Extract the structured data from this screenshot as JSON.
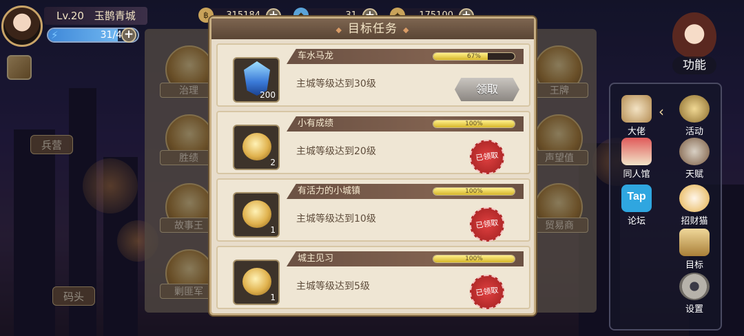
{
  "player": {
    "level_label": "Lv.20",
    "name": "玉鹊青城",
    "energy_text": "31/40",
    "energy_fraction": 0.775
  },
  "resources": [
    {
      "icon": "coin-icon",
      "value": "315184"
    },
    {
      "icon": "crystal-icon",
      "value": "31"
    },
    {
      "icon": "scroll-icon",
      "value": "175100"
    }
  ],
  "left_menu": {
    "buildings": [
      {
        "label": "治理"
      },
      {
        "label": "胜绩"
      },
      {
        "label": "故事王"
      },
      {
        "label": "剿匪军"
      }
    ],
    "side_labels": {
      "barracks": "兵营",
      "dock": "码头"
    }
  },
  "right_menu_behind": [
    {
      "label": "王牌"
    },
    {
      "label": "声望值"
    },
    {
      "label": "贸易商"
    }
  ],
  "right_functions": {
    "top": {
      "label": "功能"
    },
    "items": [
      {
        "label": "大佬",
        "icon": "boss-icon"
      },
      {
        "label": "活动",
        "icon": "event-icon"
      },
      {
        "label": "同人馆",
        "icon": "fan-hall-icon"
      },
      {
        "label": "天赋",
        "icon": "talent-icon"
      },
      {
        "label": "论坛",
        "icon": "tap-forum-icon",
        "badge": "Tap"
      },
      {
        "label": "招财猫",
        "icon": "lucky-cat-icon"
      },
      {
        "label": "目标",
        "icon": "goal-icon"
      },
      {
        "label": "设置",
        "icon": "settings-gear-icon"
      }
    ]
  },
  "modal": {
    "title": "目标任务",
    "tasks": [
      {
        "name": "车水马龙",
        "desc": "主城等级达到30级",
        "progress_text": "67%",
        "progress": 0.67,
        "reward_icon": "gem-icon",
        "reward_count": "200",
        "status": "claim",
        "button_label": "领取"
      },
      {
        "name": "小有成绩",
        "desc": "主城等级达到20级",
        "progress_text": "100%",
        "progress": 1.0,
        "reward_icon": "gold-coin-icon",
        "reward_count": "2",
        "status": "claimed",
        "stamp_label": "已领取"
      },
      {
        "name": "有活力的小城镇",
        "desc": "主城等级达到10级",
        "progress_text": "100%",
        "progress": 1.0,
        "reward_icon": "gold-coin-icon",
        "reward_count": "1",
        "status": "claimed",
        "stamp_label": "已领取"
      },
      {
        "name": "城主见习",
        "desc": "主城等级达到5级",
        "progress_text": "100%",
        "progress": 1.0,
        "reward_icon": "gold-coin-icon",
        "reward_count": "1",
        "status": "claimed",
        "stamp_label": "已领取"
      }
    ]
  },
  "colors": {
    "modal_bg": "#e8ddcb",
    "title_bar": "#5a4535",
    "progress_fill": "#d6b62a",
    "claimed_stamp": "#b42a2a",
    "claim_button": "#8c8782"
  }
}
